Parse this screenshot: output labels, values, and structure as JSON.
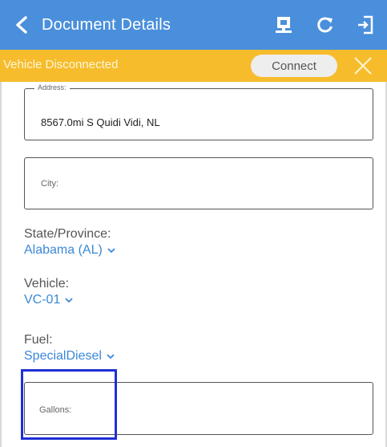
{
  "header": {
    "title": "Document Details"
  },
  "banner": {
    "status_text": "Vehicle Disconnected",
    "connect_label": "Connect"
  },
  "form": {
    "address": {
      "label": "Address:",
      "value": "8567.0mi S Quidi Vidi, NL"
    },
    "city": {
      "placeholder": "City:"
    },
    "state": {
      "label": "State/Province:",
      "value": "Alabama (AL)"
    },
    "vehicle": {
      "label": "Vehicle:",
      "value": "VC-01"
    },
    "fuel": {
      "label": "Fuel:",
      "value": "SpecialDiesel"
    },
    "gallons": {
      "placeholder": "Gallons:"
    }
  },
  "colors": {
    "header_bg": "#4a8fdb",
    "banner_bg": "#f6bc2c",
    "link_blue": "#3a88d8",
    "highlight": "#1f2fd6"
  },
  "icons": {
    "back": "chevron-left-icon",
    "monitor": "monitor-icon",
    "refresh": "refresh-icon",
    "logout": "logout-icon",
    "close": "close-icon",
    "dropdown": "chevron-down-icon"
  }
}
